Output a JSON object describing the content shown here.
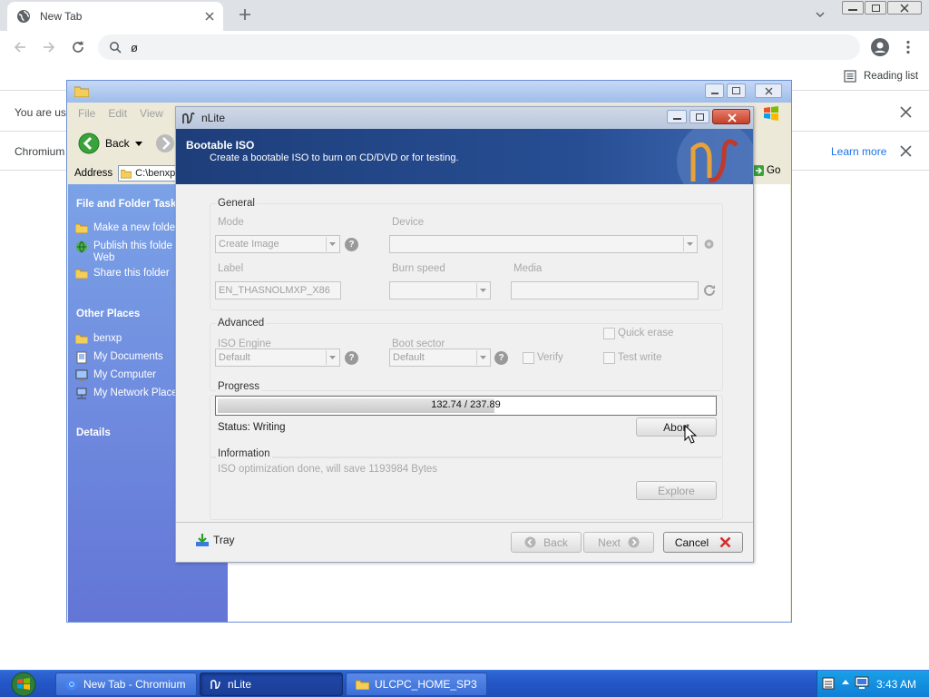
{
  "browser": {
    "tab_title": "New Tab",
    "omnibox_text": "ø",
    "reading_list": "Reading list",
    "infobar1_text": "You are usi",
    "infobar2_text": "Chromium",
    "learn_more": "Learn more"
  },
  "explorer": {
    "menu": [
      "File",
      "Edit",
      "View"
    ],
    "back_label": "Back",
    "address_label": "Address",
    "address_value": "C:\\benxp",
    "go_label": "Go",
    "tasks_header": "File and Folder Tasks",
    "tasks": [
      "Make a new folde",
      "Publish this folde\nWeb",
      "Share this folder"
    ],
    "other_header": "Other Places",
    "places": [
      "benxp",
      "My Documents",
      "My Computer",
      "My Network Place"
    ],
    "details_header": "Details"
  },
  "nlite": {
    "title": "nLite",
    "header_title": "Bootable ISO",
    "header_subtitle": "Create a bootable ISO to burn on CD/DVD or for testing.",
    "general": {
      "label": "General",
      "mode_label": "Mode",
      "mode_value": "Create Image",
      "device_label": "Device",
      "label_label": "Label",
      "label_value": "EN_THASNOLMXP_X86",
      "burn_speed_label": "Burn speed",
      "media_label": "Media"
    },
    "advanced": {
      "label": "Advanced",
      "iso_engine_label": "ISO Engine",
      "iso_engine_value": "Default",
      "boot_sector_label": "Boot sector",
      "boot_sector_value": "Default",
      "verify_label": "Verify",
      "quick_erase_label": "Quick erase",
      "test_write_label": "Test write"
    },
    "progress": {
      "label": "Progress",
      "text": "132.74 / 237.89",
      "fraction": 0.558,
      "status": "Status: Writing",
      "abort_label": "Abort"
    },
    "information": {
      "label": "Information",
      "text": "ISO optimization done, will save 1193984 Bytes",
      "explore_label": "Explore"
    },
    "footer": {
      "tray_label": "Tray",
      "back_label": "Back",
      "next_label": "Next",
      "cancel_label": "Cancel"
    }
  },
  "taskbar": {
    "items": [
      "New Tab - Chromium",
      "nLite",
      "ULCPC_HOME_SP3"
    ],
    "clock": "3:43 AM"
  },
  "colors": {
    "nlite_header": "#274e93",
    "xp_taskbar": "#2456c8",
    "xp_side_panel": "#6b86dc"
  }
}
